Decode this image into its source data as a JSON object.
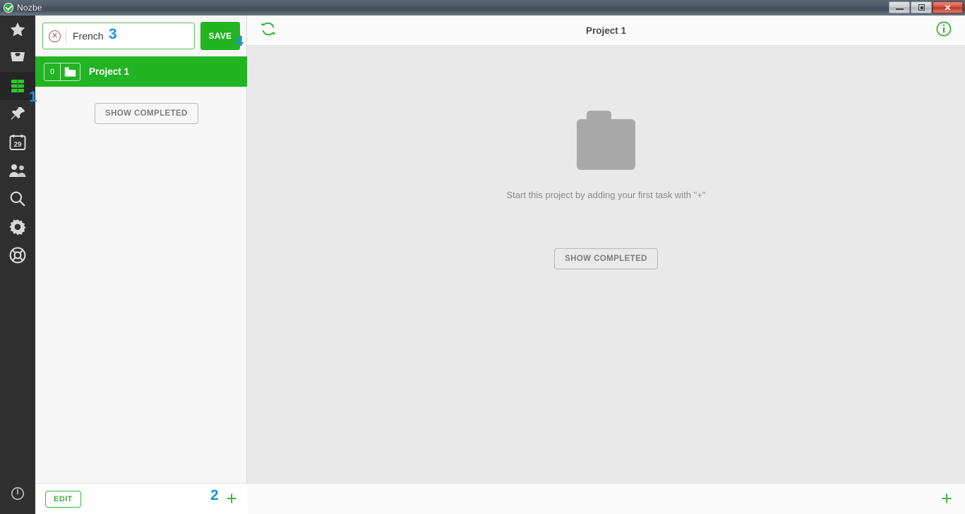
{
  "window": {
    "app_title": "Nozbe",
    "app_icon": "check-circle-icon",
    "minimize_label": "",
    "restore_label": "",
    "close_label": "✕"
  },
  "rail": {
    "items": [
      {
        "name": "priority",
        "icon": "star-icon"
      },
      {
        "name": "inbox",
        "icon": "inbox-icon"
      },
      {
        "name": "projects",
        "icon": "projects-icon",
        "active": true
      },
      {
        "name": "labels",
        "icon": "pin-icon"
      },
      {
        "name": "calendar",
        "icon": "calendar-icon",
        "badge": "29"
      },
      {
        "name": "team",
        "icon": "team-icon"
      },
      {
        "name": "search",
        "icon": "search-icon"
      },
      {
        "name": "settings",
        "icon": "gear-icon"
      },
      {
        "name": "help",
        "icon": "lifebuoy-icon"
      }
    ],
    "power": {
      "name": "logout",
      "icon": "power-icon"
    }
  },
  "left_panel": {
    "search": {
      "value": "French",
      "placeholder": "",
      "clear_icon": "clear-circle-icon"
    },
    "save_label": "SAVE",
    "project": {
      "count": "0",
      "name": "Project 1",
      "icon": "folder-icon"
    },
    "show_completed_label": "SHOW COMPLETED",
    "edit_label": "EDIT",
    "add_label": "+"
  },
  "main_panel": {
    "sync_icon": "sync-icon",
    "title": "Project 1",
    "info_icon": "info-icon",
    "empty_state": {
      "icon": "folder-icon",
      "text": "Start this project by adding your first task with \"+\""
    },
    "show_completed_label": "SHOW COMPLETED",
    "add_label": "+"
  },
  "annotations": [
    {
      "label": "1"
    },
    {
      "label": "2"
    },
    {
      "label": "3"
    },
    {
      "label": "4"
    }
  ],
  "colors": {
    "accent_green": "#22b422",
    "annotation_blue": "#1f90d8",
    "rail_dark": "#2f2f2f",
    "panel_gray": "#e9e9e9"
  }
}
